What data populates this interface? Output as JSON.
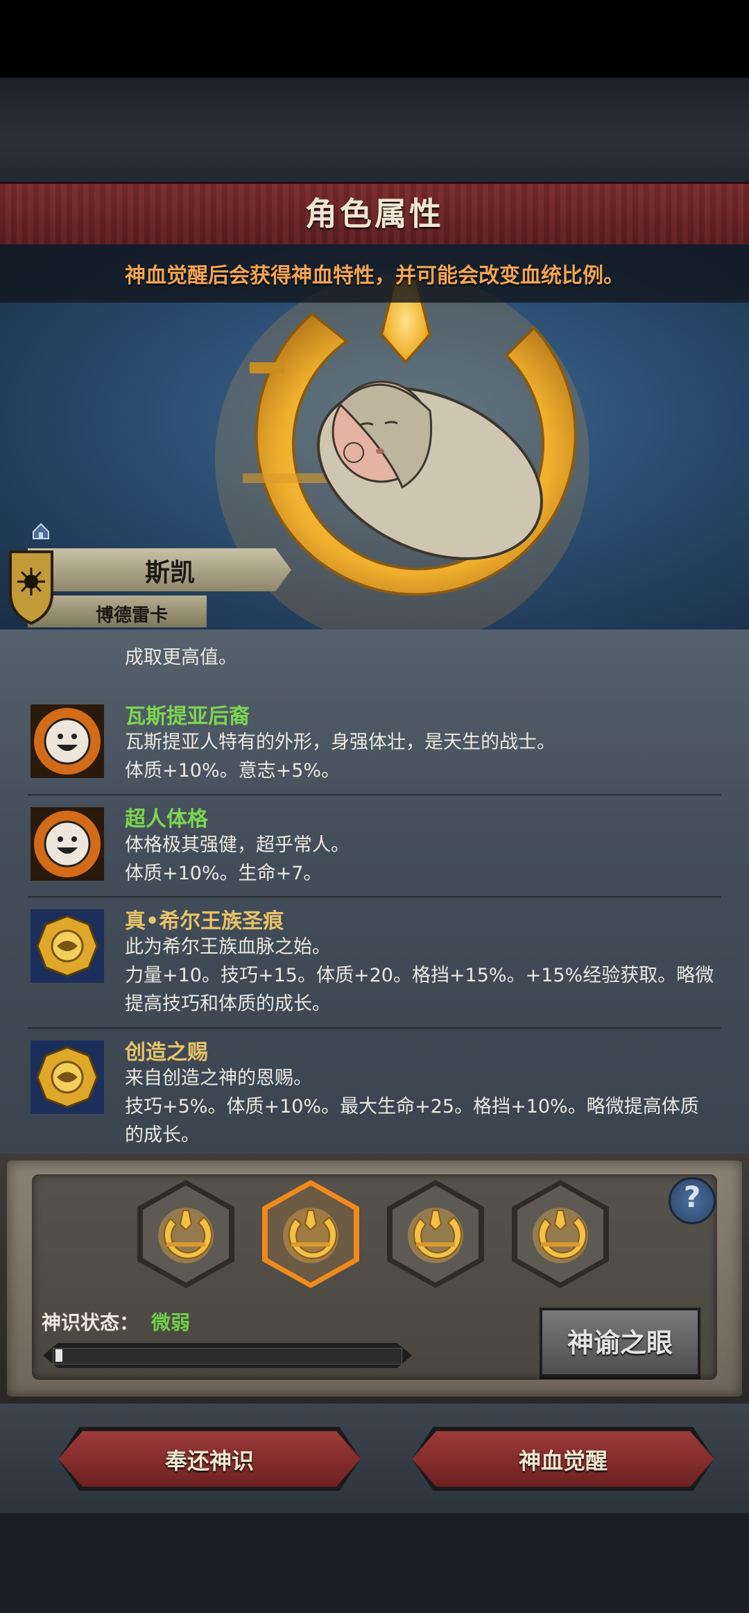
{
  "header": {
    "title": "角色属性"
  },
  "hero": {
    "tip": "神血觉醒后会获得神血特性，并可能会改变血统比例。"
  },
  "character": {
    "name": "斯凯",
    "house": "博德雷卡"
  },
  "traits": {
    "partial_line": "成取更高值。",
    "items": [
      {
        "name": "瓦斯提亚后裔",
        "name_color": "#7cd64e",
        "icon": "smile-face-icon",
        "lines": [
          "瓦斯提亚人特有的外形，身强体壮，是天生的战士。",
          "体质+10%。意志+5%。"
        ]
      },
      {
        "name": "超人体格",
        "name_color": "#7cd64e",
        "icon": "smile-face-icon",
        "lines": [
          "体格极其强健，超乎常人。",
          "体质+10%。生命+7。"
        ]
      },
      {
        "name": "真•希尔王族圣痕",
        "name_color": "#e8c26a",
        "icon": "golden-sigil-icon",
        "lines": [
          "此为希尔王族血脉之始。",
          "力量+10。技巧+15。体质+20。格挡+15%。+15%经验获取。略微",
          "提高技巧和体质的成长。"
        ]
      },
      {
        "name": "创造之赐",
        "name_color": "#e8c26a",
        "icon": "golden-sigil-icon",
        "lines": [
          "来自创造之神的恩赐。",
          "技巧+5%。体质+10%。最大生命+25。格挡+10%。略微提高体质",
          "的成长。"
        ]
      }
    ]
  },
  "panel": {
    "status_label": "神识状态：",
    "status_value": "微弱",
    "progress": 0.02,
    "help": "?",
    "oracle_button": "神谕之眼",
    "slots": [
      {
        "icon": "crescent-emblem-icon",
        "selected": false
      },
      {
        "icon": "crescent-emblem-icon",
        "selected": true
      },
      {
        "icon": "crescent-emblem-icon",
        "selected": false
      },
      {
        "icon": "crescent-emblem-icon",
        "selected": false
      }
    ]
  },
  "actions": {
    "return_label": "奉还神识",
    "awaken_label": "神血觉醒"
  },
  "colors": {
    "accent_gold": "#f2a553",
    "status_green": "#6fcf4a",
    "banner_red": "#7a2a2c"
  }
}
